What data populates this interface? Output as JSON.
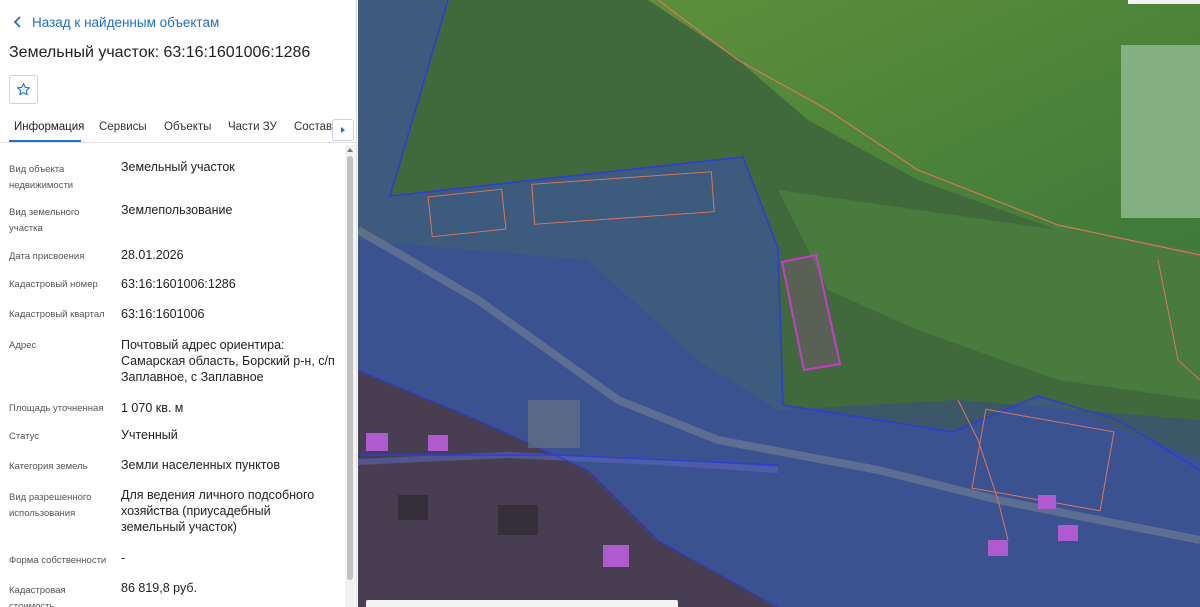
{
  "back_link": "Назад к найденным объектам",
  "title": "Земельный участок: 63:16:1601006:1286",
  "tabs": [
    "Информация",
    "Сервисы",
    "Объекты",
    "Части ЗУ",
    "Состав"
  ],
  "active_tab": "Информация",
  "fields": [
    {
      "label_lines": [
        "Вид объекта",
        "недвижимости"
      ],
      "value_lines": [
        "Земельный участок"
      ]
    },
    {
      "label_lines": [
        "Вид земельного",
        "участка"
      ],
      "value_lines": [
        "Землепользование"
      ]
    },
    {
      "label_lines": [
        "Дата присвоения"
      ],
      "value_lines": [
        "28.01.2026"
      ]
    },
    {
      "label_lines": [
        "Кадастровый номер"
      ],
      "value_lines": [
        "63:16:1601006:1286"
      ]
    },
    {
      "label_lines": [
        "Кадастровый квартал"
      ],
      "value_lines": [
        "63:16:1601006"
      ]
    },
    {
      "label_lines": [
        "Адрес"
      ],
      "value_lines": [
        "Почтовый адрес ориентира:",
        "Самарская область, Борский р-н, с/п",
        "Заплавное, с Заплавное"
      ]
    },
    {
      "label_lines": [
        "Площадь уточненная"
      ],
      "value_lines": [
        "1 070 кв. м"
      ]
    },
    {
      "label_lines": [
        "Статус"
      ],
      "value_lines": [
        "Учтенный"
      ]
    },
    {
      "label_lines": [
        "Категория земель"
      ],
      "value_lines": [
        "Земли населенных пунктов"
      ]
    },
    {
      "label_lines": [
        "Вид разрешенного",
        "использования"
      ],
      "value_lines": [
        "Для ведения личного подсобного",
        "хозяйства (приусадебный",
        "земельный участок)"
      ]
    },
    {
      "label_lines": [
        "Форма собственности"
      ],
      "value_lines": [
        "-"
      ]
    },
    {
      "label_lines": [
        "Кадастровая",
        "стоимость"
      ],
      "value_lines": [
        "86 819,8 руб."
      ]
    }
  ],
  "colors": {
    "accent": "#1f6fc5",
    "parcel_highlight": "#c83cc8",
    "boundary_blue": "#2b3fd6",
    "boundary_red": "#d9765b"
  },
  "icons": {
    "back": "chevron-left-icon",
    "favorite": "star-outline-icon",
    "tabs_next": "triangle-right-icon"
  }
}
